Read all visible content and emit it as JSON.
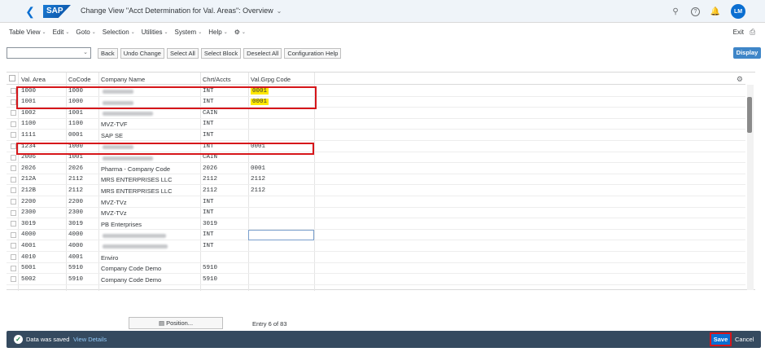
{
  "shell": {
    "logo": "SAP",
    "title": "Change View \"Acct Determination for Val. Areas\": Overview",
    "avatar": "LM"
  },
  "menu": [
    "Table View",
    "Edit",
    "Goto",
    "Selection",
    "Utilities",
    "System",
    "Help"
  ],
  "exit_label": "Exit",
  "toolbar": {
    "buttons": [
      "Back",
      "Undo Change",
      "Select All",
      "Select Block",
      "Deselect All",
      "Configuration Help"
    ],
    "display": "Display"
  },
  "table": {
    "headers": [
      "Val. Area",
      "CoCode",
      "Company Name",
      "Chrt/Accts",
      "Val.Grpg Code"
    ],
    "rows": [
      {
        "val_area": "1000",
        "cocode": "1000",
        "company": "",
        "chrt": "INT",
        "grp": "0001"
      },
      {
        "val_area": "1001",
        "cocode": "1000",
        "company": "",
        "chrt": "INT",
        "grp": "0001"
      },
      {
        "val_area": "1002",
        "cocode": "1001",
        "company": "",
        "chrt": "CAIN",
        "grp": ""
      },
      {
        "val_area": "1100",
        "cocode": "1100",
        "company": "MVZ-TVF",
        "chrt": "INT",
        "grp": ""
      },
      {
        "val_area": "1111",
        "cocode": "0001",
        "company": "SAP SE",
        "chrt": "INT",
        "grp": ""
      },
      {
        "val_area": "1234",
        "cocode": "1000",
        "company": "",
        "chrt": "INT",
        "grp": "0001"
      },
      {
        "val_area": "2006",
        "cocode": "1001",
        "company": "",
        "chrt": "CAIN",
        "grp": ""
      },
      {
        "val_area": "2026",
        "cocode": "2026",
        "company": "Pharma - Company Code",
        "chrt": "2026",
        "grp": "0001"
      },
      {
        "val_area": "212A",
        "cocode": "2112",
        "company": "MRS ENTERPRISES LLC",
        "chrt": "2112",
        "grp": "2112"
      },
      {
        "val_area": "212B",
        "cocode": "2112",
        "company": "MRS ENTERPRISES LLC",
        "chrt": "2112",
        "grp": "2112"
      },
      {
        "val_area": "2200",
        "cocode": "2200",
        "company": "MVZ-TVz",
        "chrt": "INT",
        "grp": ""
      },
      {
        "val_area": "2300",
        "cocode": "2300",
        "company": "MVZ-TVz",
        "chrt": "INT",
        "grp": ""
      },
      {
        "val_area": "3019",
        "cocode": "3019",
        "company": "PB Enterprises",
        "chrt": "3019",
        "grp": ""
      },
      {
        "val_area": "4000",
        "cocode": "4000",
        "company": "",
        "chrt": "INT",
        "grp": ""
      },
      {
        "val_area": "4001",
        "cocode": "4000",
        "company": "",
        "chrt": "INT",
        "grp": ""
      },
      {
        "val_area": "4010",
        "cocode": "4001",
        "company": "Enviro",
        "chrt": "",
        "grp": ""
      },
      {
        "val_area": "5001",
        "cocode": "5910",
        "company": "Company Code Demo",
        "chrt": "5910",
        "grp": ""
      },
      {
        "val_area": "5002",
        "cocode": "5910",
        "company": "Company Code Demo",
        "chrt": "5910",
        "grp": ""
      }
    ]
  },
  "position_label": "Position...",
  "entry_text": "Entry 6 of 83",
  "footer": {
    "status": "Data was saved",
    "view_details": "View Details",
    "save": "Save",
    "cancel": "Cancel"
  }
}
